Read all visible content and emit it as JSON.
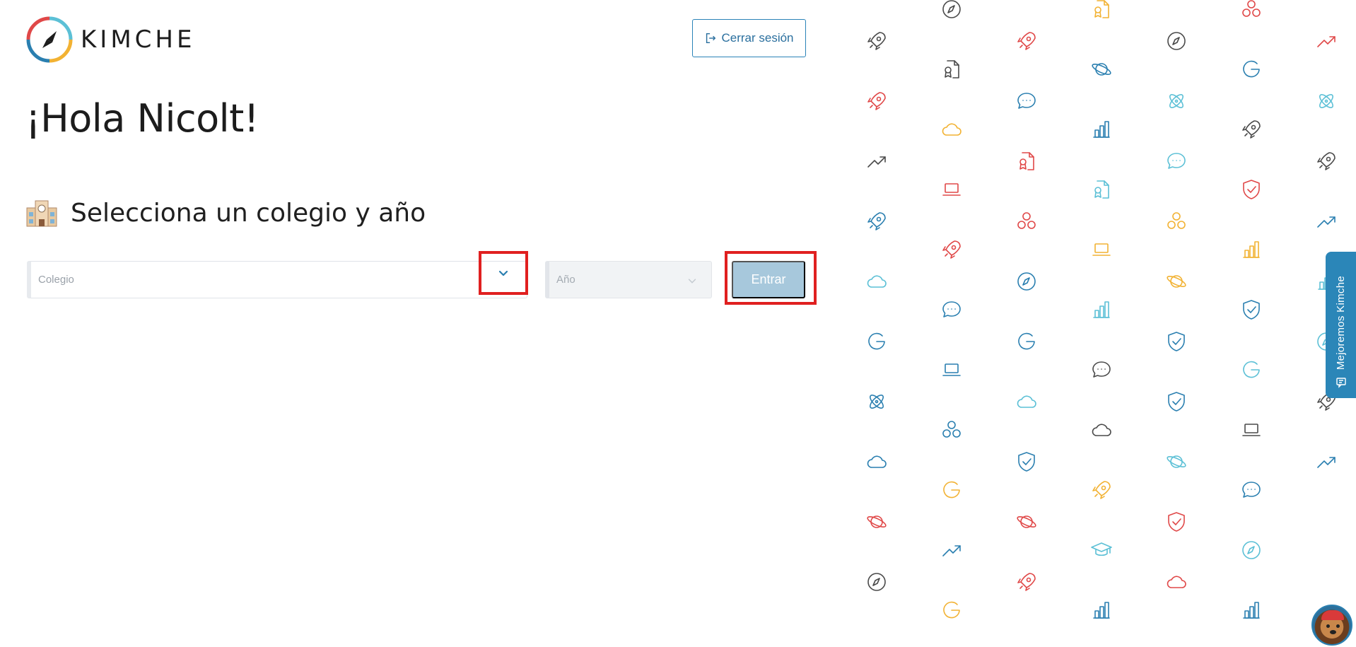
{
  "brand": {
    "name": "KIMCHE",
    "colors": {
      "red": "#e04848",
      "blue": "#2a7fb0",
      "yellow": "#f2b233",
      "teal": "#5cc0d6"
    }
  },
  "header": {
    "logout_label": "Cerrar sesión",
    "logout_icon": "logout-icon"
  },
  "main": {
    "greeting": "¡Hola Nicolt!",
    "section_title": "Selecciona un colegio y año",
    "section_icon": "school-emoji",
    "colegio_placeholder": "Colegio",
    "anio_placeholder": "Año",
    "submit_label": "Entrar",
    "submit_enabled": false
  },
  "feedback_tab": {
    "label": "Mejoremos Kimche",
    "icon": "chat-icon"
  },
  "avatar": {
    "description_icon": "dog-avatar-icon"
  },
  "pattern": {
    "palette": [
      "#e04848",
      "#2a7fb0",
      "#f2b233",
      "#5cc0d6",
      "#4a4a4a"
    ],
    "columns": [
      [
        "rocket",
        "rocket",
        "trend",
        "rocket",
        "cloud",
        "google",
        "atom",
        "cloud",
        "planet",
        "compass",
        "rocket"
      ],
      [
        "compass",
        "certificate",
        "cloud",
        "laptop",
        "rocket",
        "chat",
        "laptop",
        "circles",
        "google",
        "trend",
        "google"
      ],
      [
        "rocket",
        "chat",
        "certificate",
        "circles",
        "compass",
        "google",
        "cloud",
        "shield",
        "planet",
        "rocket"
      ],
      [
        "certificate",
        "planet",
        "chart",
        "certificate",
        "laptop",
        "chart",
        "chat",
        "cloud",
        "rocket",
        "graduation",
        "chart"
      ],
      [
        "compass",
        "atom",
        "chat",
        "circles",
        "planet",
        "shield",
        "shield",
        "planet",
        "shield",
        "cloud"
      ],
      [
        "circles",
        "google",
        "rocket",
        "shield",
        "chart",
        "shield",
        "google",
        "laptop",
        "chat",
        "compass",
        "chart"
      ],
      [
        "trend",
        "atom",
        "rocket",
        "trend",
        "chart",
        "compass",
        "rocket",
        "trend"
      ]
    ],
    "column_colors": [
      [
        "#4a4a4a",
        "#e04848",
        "#4a4a4a",
        "#2a7fb0",
        "#5cc0d6",
        "#2a7fb0",
        "#2a7fb0",
        "#2a7fb0",
        "#e04848",
        "#4a4a4a",
        "#4a4a4a"
      ],
      [
        "#4a4a4a",
        "#4a4a4a",
        "#f2b233",
        "#e04848",
        "#e04848",
        "#2a7fb0",
        "#2a7fb0",
        "#2a7fb0",
        "#f2b233",
        "#2a7fb0",
        "#f2b233"
      ],
      [
        "#e04848",
        "#2a7fb0",
        "#e04848",
        "#e04848",
        "#2a7fb0",
        "#2a7fb0",
        "#5cc0d6",
        "#2a7fb0",
        "#e04848",
        "#e04848"
      ],
      [
        "#f2b233",
        "#2a7fb0",
        "#2a7fb0",
        "#5cc0d6",
        "#f2b233",
        "#5cc0d6",
        "#4a4a4a",
        "#4a4a4a",
        "#f2b233",
        "#5cc0d6",
        "#2a7fb0"
      ],
      [
        "#4a4a4a",
        "#5cc0d6",
        "#5cc0d6",
        "#f2b233",
        "#f2b233",
        "#2a7fb0",
        "#2a7fb0",
        "#5cc0d6",
        "#e04848",
        "#e04848"
      ],
      [
        "#e04848",
        "#2a7fb0",
        "#4a4a4a",
        "#e04848",
        "#f2b233",
        "#2a7fb0",
        "#5cc0d6",
        "#4a4a4a",
        "#2a7fb0",
        "#5cc0d6",
        "#2a7fb0"
      ],
      [
        "#e04848",
        "#5cc0d6",
        "#4a4a4a",
        "#2a7fb0",
        "#5cc0d6",
        "#5cc0d6",
        "#4a4a4a",
        "#2a7fb0"
      ]
    ]
  }
}
